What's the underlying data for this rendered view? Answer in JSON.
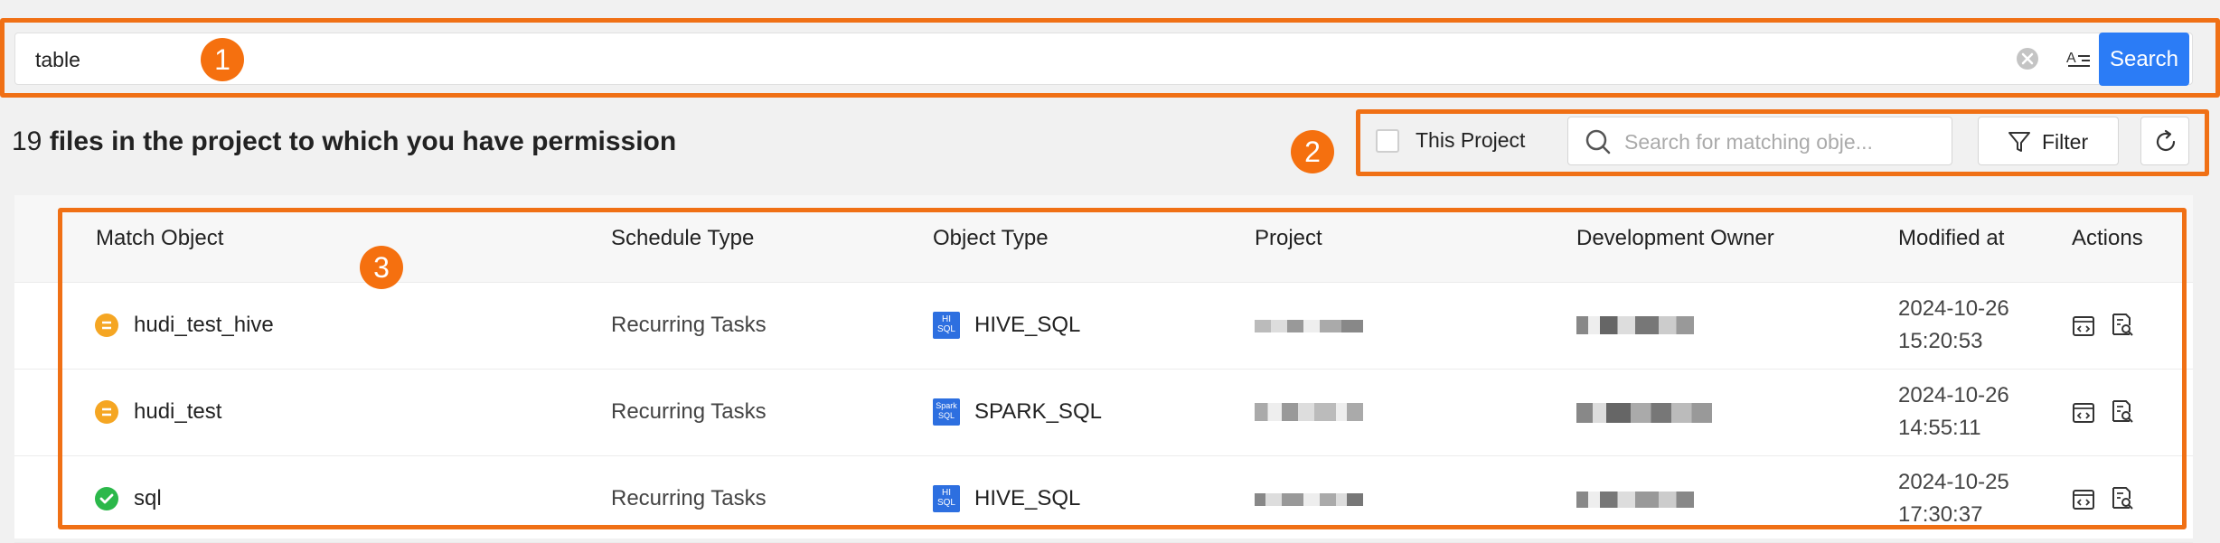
{
  "search": {
    "value": "table",
    "button_label": "Search"
  },
  "summary": {
    "count": "19",
    "text": " files in the project to which you have permission"
  },
  "toolbar": {
    "this_project_label": "This Project",
    "object_search_placeholder": "Search for matching obje...",
    "filter_label": "Filter"
  },
  "annotations": [
    "1",
    "2",
    "3"
  ],
  "table": {
    "columns": [
      "Match Object",
      "Schedule Type",
      "Object Type",
      "Project",
      "Development Owner",
      "Modified at",
      "Actions"
    ],
    "rows": [
      {
        "name": "hudi_test_hive",
        "status": "pending",
        "schedule": "Recurring Tasks",
        "type": "HIVE_SQL",
        "type_badge": "HI SQL",
        "date": "2024-10-26",
        "time": "15:20:53"
      },
      {
        "name": "hudi_test",
        "status": "pending",
        "schedule": "Recurring Tasks",
        "type": "SPARK_SQL",
        "type_badge": "Spark SQL",
        "date": "2024-10-26",
        "time": "14:55:11"
      },
      {
        "name": "sql",
        "status": "success",
        "schedule": "Recurring Tasks",
        "type": "HIVE_SQL",
        "type_badge": "HI SQL",
        "date": "2024-10-25",
        "time": "17:30:37"
      }
    ]
  },
  "colors": {
    "accent": "#2b7cf6",
    "highlight": "#f07015",
    "pending": "#f5a623",
    "success": "#2bb84a"
  }
}
